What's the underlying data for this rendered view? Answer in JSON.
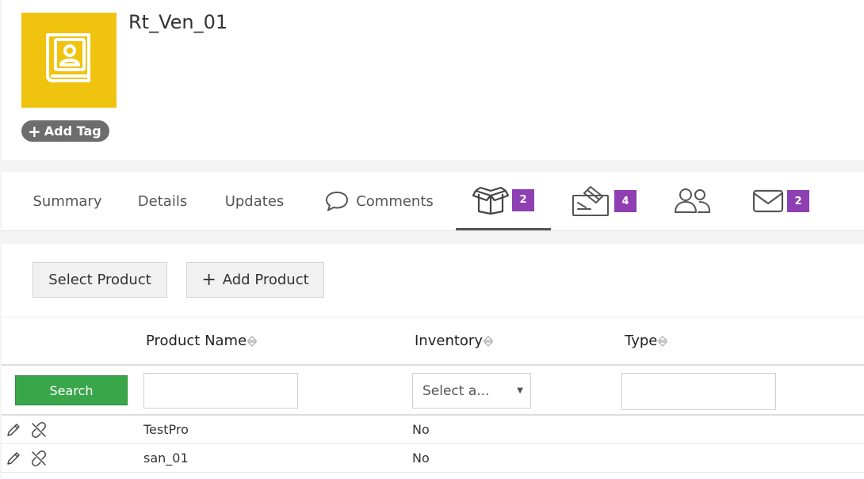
{
  "record": {
    "title": "Rt_Ven_01",
    "avatar_icon": "contact-book-icon",
    "avatar_color": "#f0c30f",
    "add_tag_label": "Add Tag"
  },
  "tabs": [
    {
      "label": "Summary"
    },
    {
      "label": "Details"
    },
    {
      "label": "Updates"
    },
    {
      "label": "Comments",
      "icon": "comment-icon"
    },
    {
      "label": "",
      "icon": "box-icon",
      "badge": "2",
      "active": true
    },
    {
      "label": "",
      "icon": "signature-icon",
      "badge": "4"
    },
    {
      "label": "",
      "icon": "users-icon"
    },
    {
      "label": "",
      "icon": "envelope-icon",
      "badge": "2"
    }
  ],
  "badge_color": "#8e3fb2",
  "toolbar": {
    "select_product_label": "Select Product",
    "add_product_label": "Add Product"
  },
  "table": {
    "columns": [
      "Product Name",
      "Inventory",
      "Type"
    ],
    "search_label": "Search",
    "inventory_placeholder": "Select a...",
    "rows": [
      {
        "product_name": "TestPro",
        "inventory": "No",
        "type": ""
      },
      {
        "product_name": "san_01",
        "inventory": "No",
        "type": ""
      }
    ]
  },
  "search_color": "#3aa64a"
}
